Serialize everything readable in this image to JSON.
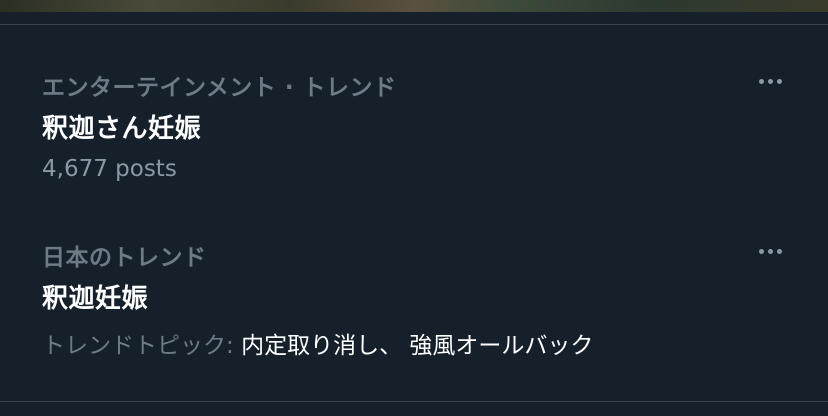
{
  "trends": [
    {
      "context": "エンターテインメント · トレンド",
      "title": "釈迦さん妊娠",
      "meta": "4,677 posts"
    },
    {
      "context": "日本のトレンド",
      "title": "釈迦妊娠",
      "topic_prefix": "トレンドトピック: ",
      "topic_values": "内定取り消し、 強風オールバック"
    }
  ],
  "icons": {
    "more": "more-horizontal-icon"
  },
  "colors": {
    "background": "#15202b",
    "primary_text": "#ffffff",
    "secondary_text": "#6e7a85",
    "divider": "#38444d"
  }
}
